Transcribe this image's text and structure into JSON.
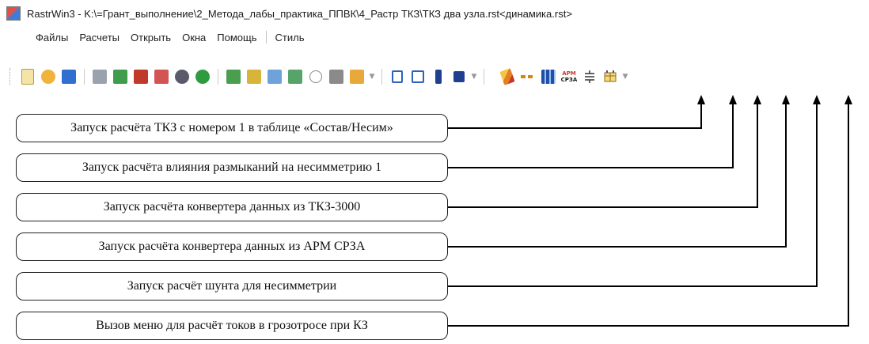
{
  "window": {
    "title": "RastrWin3 - K:\\=Грант_выполнение\\2_Метода_лабы_практика_ППВК\\4_Растр ТКЗ\\ТКЗ два узла.rst<динамика.rst>"
  },
  "menu": {
    "items": [
      "Файлы",
      "Расчеты",
      "Открыть",
      "Окна",
      "Помощь",
      "Стиль"
    ]
  },
  "toolbar": {
    "right_icons": [
      "pencil-icon",
      "dash-line-icon",
      "table-blue-icon",
      "arm-srza-icon",
      "shunt-icon",
      "grozotros-icon"
    ],
    "right_icon_texts": {
      "arm_top": "АРМ",
      "arm_bottom": "СРЗА"
    }
  },
  "callouts": [
    "Запуск расчёта ТКЗ с номером 1 в таблице «Состав/Несим»",
    "Запуск расчёта влияния размыканий на несимметрию 1",
    "Запуск расчёта конвертера данных из ТКЗ-3000",
    "Запуск расчёта конвертера данных из АРМ СРЗА",
    "Запуск расчёт шунта для несимметрии",
    "Вызов меню для расчёт токов в грозотросе при КЗ"
  ]
}
